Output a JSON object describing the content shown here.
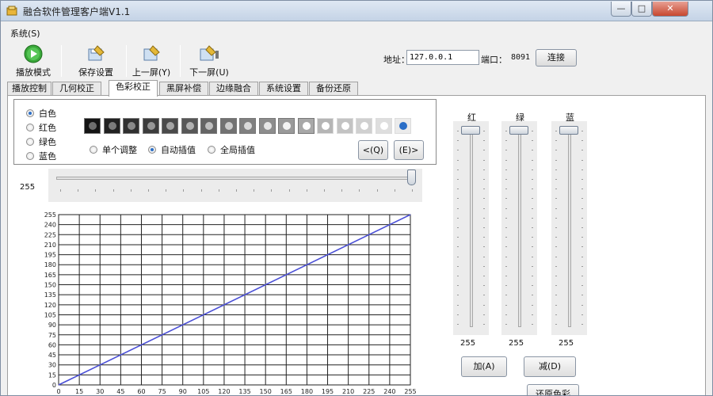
{
  "window": {
    "title": "融合软件管理客户端V1.1",
    "min_glyph": "—",
    "max_glyph": "□",
    "close_glyph": "✕"
  },
  "menu": {
    "system": "系统(S)"
  },
  "toolbar": {
    "play_mode": "播放模式",
    "save_settings": "保存设置",
    "prev_screen": "上一屏(Y)",
    "next_screen": "下一屏(U)"
  },
  "connection": {
    "address_label": "地址：",
    "address_value": "127.0.0.1",
    "port_label": "端口：",
    "port_value": "8091",
    "connect_button": "连接"
  },
  "tabs": [
    "播放控制",
    "几何校正",
    "色彩校正",
    "黑屏补偿",
    "边缘融合",
    "系统设置",
    "备份还原"
  ],
  "active_tab": 2,
  "color_mode": {
    "options": [
      "白色",
      "红色",
      "绿色",
      "蓝色"
    ],
    "selected": 0
  },
  "gray_levels": {
    "count": 17,
    "selected_index": 16
  },
  "adjust_mode": {
    "options": [
      "单个调整",
      "自动插值",
      "全局插值"
    ],
    "selected": 1
  },
  "nav": {
    "prev": "<(Q)",
    "next": "(E)>"
  },
  "level": {
    "value": "255",
    "slider_fraction": 1.0
  },
  "channels": [
    {
      "label": "红",
      "value": "255"
    },
    {
      "label": "绿",
      "value": "255"
    },
    {
      "label": "蓝",
      "value": "255"
    }
  ],
  "buttons": {
    "add": "加(A)",
    "subtract": "减(D)",
    "restore": "还原色彩"
  },
  "chart_data": {
    "type": "line",
    "x": [
      0,
      255
    ],
    "series": [
      {
        "values": [
          0,
          255
        ],
        "color": "#4a4fd6"
      }
    ],
    "xlim": [
      0,
      255
    ],
    "ylim": [
      0,
      255
    ],
    "xticks": [
      "0",
      "15",
      "30",
      "45",
      "60",
      "75",
      "90",
      "105",
      "120",
      "135",
      "150",
      "165",
      "180",
      "195",
      "210",
      "225",
      "240",
      "255"
    ],
    "yticks": [
      "0",
      "15",
      "30",
      "45",
      "60",
      "75",
      "90",
      "105",
      "120",
      "135",
      "150",
      "165",
      "180",
      "195",
      "210",
      "225",
      "240",
      "255"
    ],
    "grid": true
  }
}
